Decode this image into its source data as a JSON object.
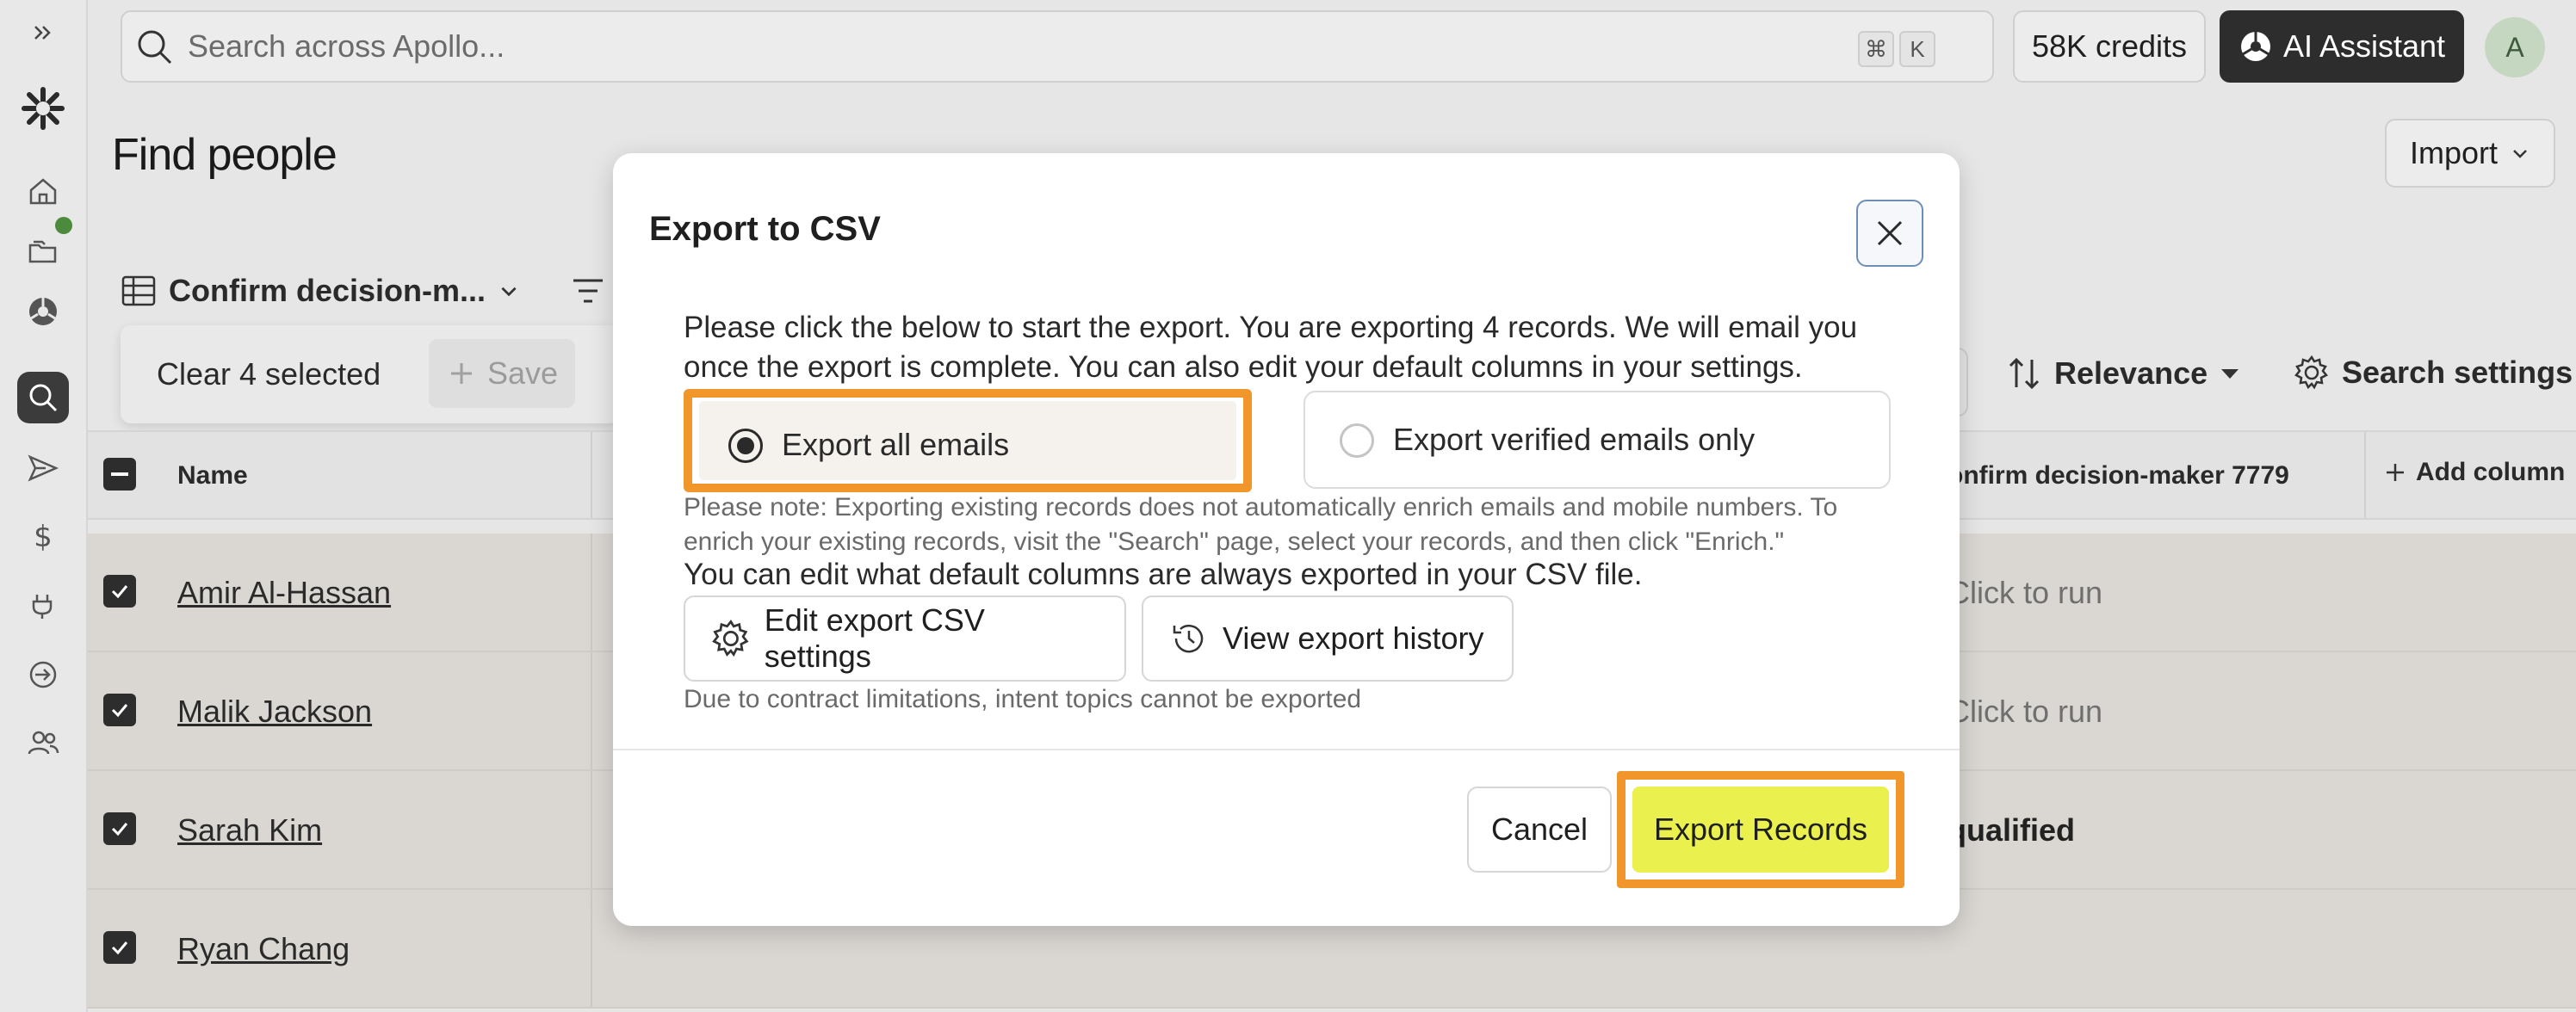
{
  "topbar": {
    "search_placeholder": "Search across Apollo...",
    "shortcut_key1": "⌘",
    "shortcut_key2": "K",
    "credits": "58K credits",
    "ai_assistant": "AI Assistant",
    "avatar_initial": "A"
  },
  "page": {
    "title": "Find people",
    "import_label": "Import"
  },
  "toolbar": {
    "view_name": "Confirm decision-m...",
    "clear_selected": "Clear 4 selected",
    "save_label": "Save",
    "sort_label": "Relevance",
    "search_settings": "Search settings"
  },
  "table": {
    "headers": {
      "name": "Name",
      "decision": "onfirm decision-maker 7779",
      "add_column": "Add column"
    },
    "rows": [
      {
        "name": "Amir Al-Hassan",
        "status": "Click to run"
      },
      {
        "name": "Malik Jackson",
        "status": "Click to run"
      },
      {
        "name": "Sarah Kim",
        "status": "qualified"
      },
      {
        "name": "Ryan Chang",
        "status": ""
      }
    ]
  },
  "modal": {
    "title": "Export to CSV",
    "description": "Please click the below to start the export. You are exporting 4 records. We will email you once the export is complete. You can also edit your default columns in your settings.",
    "option_all": "Export all emails",
    "option_verified": "Export verified emails only",
    "note": "Please note: Exporting existing records does not automatically enrich emails and mobile numbers. To enrich your existing records, visit the \"Search\" page, select your records, and then click \"Enrich.\"",
    "edit_info": "You can edit what default columns are always exported in your CSV file.",
    "edit_settings_btn": "Edit export CSV settings",
    "view_history_btn": "View export history",
    "contract_note": "Due to contract limitations, intent topics cannot be exported",
    "cancel": "Cancel",
    "export": "Export Records"
  },
  "colors": {
    "highlight": "#f0962a",
    "export_button": "#eaf14f",
    "dark_button": "#2d2d2d",
    "online": "#4c8a3e"
  }
}
